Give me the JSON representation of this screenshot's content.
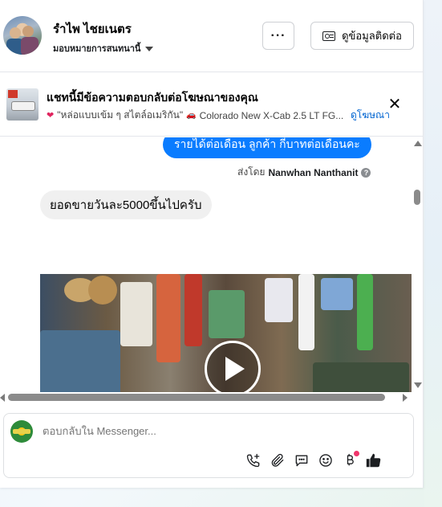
{
  "header": {
    "name": "รำไพ ไชยเนตร",
    "assign_label": "มอบหมายการสนทนานี้",
    "more_label": "···",
    "info_button_label": "ดูข้อมูลติดต่อ"
  },
  "ad_banner": {
    "title": "แชทนี้มีข้อความตอบกลับต่อโฆษณาของคุณ",
    "ad_text": "\"หล่อแบบเข้ม ๆ สไตล์อเมริกัน\"",
    "ad_product": "Colorado New X-Cab 2.5 LT FG...",
    "view_ad_link": "ดูโฆษณา",
    "close_label": "✕"
  },
  "messages": {
    "outgoing_text": "รายได้ต่อเดือน ลูกค้า  กี่บาทต่อเดือนคะ",
    "sent_by_prefix": "ส่งโดย",
    "sent_by_name": "Nanwhan Nanthanit",
    "incoming_text": "ยอดขายวันละ5000ขึ้นไปครับ"
  },
  "composer": {
    "placeholder": "ตอบกลับใน Messenger..."
  },
  "colors": {
    "accent": "#0a7cff",
    "link": "#0064d1",
    "notification": "#f0366c",
    "like": "#1c1e21"
  },
  "icons": [
    "chevron-down-icon",
    "contact-card-icon",
    "close-icon",
    "help-icon",
    "play-icon",
    "add-call-icon",
    "attachment-icon",
    "quick-reply-icon",
    "emoji-icon",
    "payment-icon",
    "like-icon"
  ]
}
